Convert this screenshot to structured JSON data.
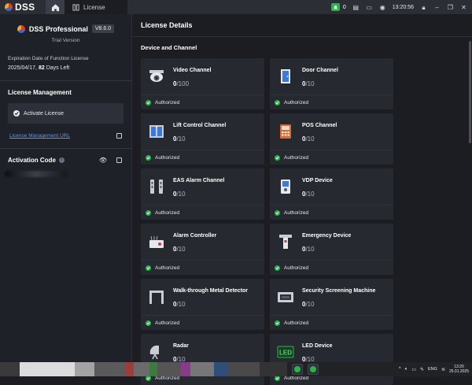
{
  "topbar": {
    "app_name": "DSS",
    "tab_label": "License",
    "notification_count": "0",
    "clock": "13:20:56",
    "colors": {
      "accent_green": "#27b64a"
    }
  },
  "sidebar": {
    "product_name": "DSS Professional",
    "version": "V8.6.0",
    "edition": "Trial Version",
    "expiration_label": "Expiration Date of Function License",
    "expiration_date": "2025/04/17,",
    "days_left_number": "82",
    "days_left_text": "Days Left",
    "license_mgmt_title": "License Management",
    "activate_button": "Activate License",
    "license_url_link": "License Management URL",
    "activation_code_title": "Activation Code"
  },
  "main": {
    "title": "License Details",
    "section_title": "Device and Channel",
    "cards": [
      {
        "name": "Video Channel",
        "used": "0",
        "total": "/100",
        "status": "Authorized",
        "icon": "dome-camera-icon"
      },
      {
        "name": "Door Channel",
        "used": "0",
        "total": "/10",
        "status": "Authorized",
        "icon": "door-icon"
      },
      {
        "name": "Lift Control Channel",
        "used": "0",
        "total": "/10",
        "status": "Authorized",
        "icon": "elevator-icon"
      },
      {
        "name": "POS Channel",
        "used": "0",
        "total": "/10",
        "status": "Authorized",
        "icon": "pos-terminal-icon"
      },
      {
        "name": "EAS Alarm Channel",
        "used": "0",
        "total": "/10",
        "status": "Authorized",
        "icon": "eas-gate-icon"
      },
      {
        "name": "VDP Device",
        "used": "0",
        "total": "/10",
        "status": "Authorized",
        "icon": "intercom-icon"
      },
      {
        "name": "Alarm Controller",
        "used": "0",
        "total": "/10",
        "status": "Authorized",
        "icon": "alarm-controller-icon"
      },
      {
        "name": "Emergency Device",
        "used": "0",
        "total": "/10",
        "status": "Authorized",
        "icon": "emergency-device-icon"
      },
      {
        "name": "Walk-through Metal Detector",
        "used": "0",
        "total": "/10",
        "status": "Authorized",
        "icon": "metal-detector-icon"
      },
      {
        "name": "Security Screening Machine",
        "used": "0",
        "total": "/10",
        "status": "Authorized",
        "icon": "xray-scanner-icon"
      },
      {
        "name": "Radar",
        "used": "0",
        "total": "/10",
        "status": "Authorized",
        "icon": "radar-icon"
      },
      {
        "name": "LED Device",
        "used": "0",
        "total": "/10",
        "status": "Authorized",
        "icon": "led-display-icon"
      }
    ]
  },
  "taskbar": {
    "language": "ENG",
    "time": "13:20",
    "date": "25.01.2025"
  }
}
